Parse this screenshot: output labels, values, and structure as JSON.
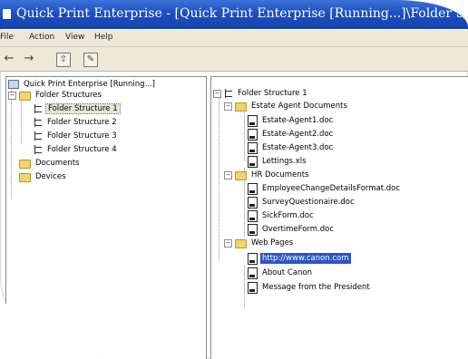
{
  "window": {
    "title": "Quick Print Enterprise - [Quick Print Enterprise [Running...]\\Folder Stru"
  },
  "menu": [
    "File",
    "Action",
    "View",
    "Help"
  ],
  "toolbar": {
    "back_icon": "back-arrow-icon",
    "forward_icon": "forward-arrow-icon",
    "up_icon": "folder-up-icon",
    "properties_icon": "properties-icon"
  },
  "left_tree": {
    "root": "Quick Print Enterprise [Running...]",
    "folder_structures": "Folder Structures",
    "structures": [
      "Folder Structure 1",
      "Folder Structure 2",
      "Folder Structure 3",
      "Folder Structure 4"
    ],
    "documents": "Documents",
    "devices": "Devices"
  },
  "right_tree": {
    "root": "Folder Structure 1",
    "estate": {
      "label": "Estate Agent Documents",
      "items": [
        "Estate-Agent1.doc",
        "Estate-Agent2.doc",
        "Estate-Agent3.doc",
        "Lettings.xls"
      ]
    },
    "hr": {
      "label": "HR Documents",
      "items": [
        "EmployeeChangeDetailsFormat.doc",
        "SurveyQuestionaire.doc",
        "SickForm.doc",
        "OvertimeForm.doc"
      ]
    },
    "web": {
      "label": "Web Pages",
      "items": [
        "http://www.canon.com",
        "About Canon",
        "Message from the President"
      ]
    }
  },
  "colors": {
    "titlebar": "#1d4fc0",
    "selection": "#2b55c8",
    "folder": "#f2d46a"
  }
}
